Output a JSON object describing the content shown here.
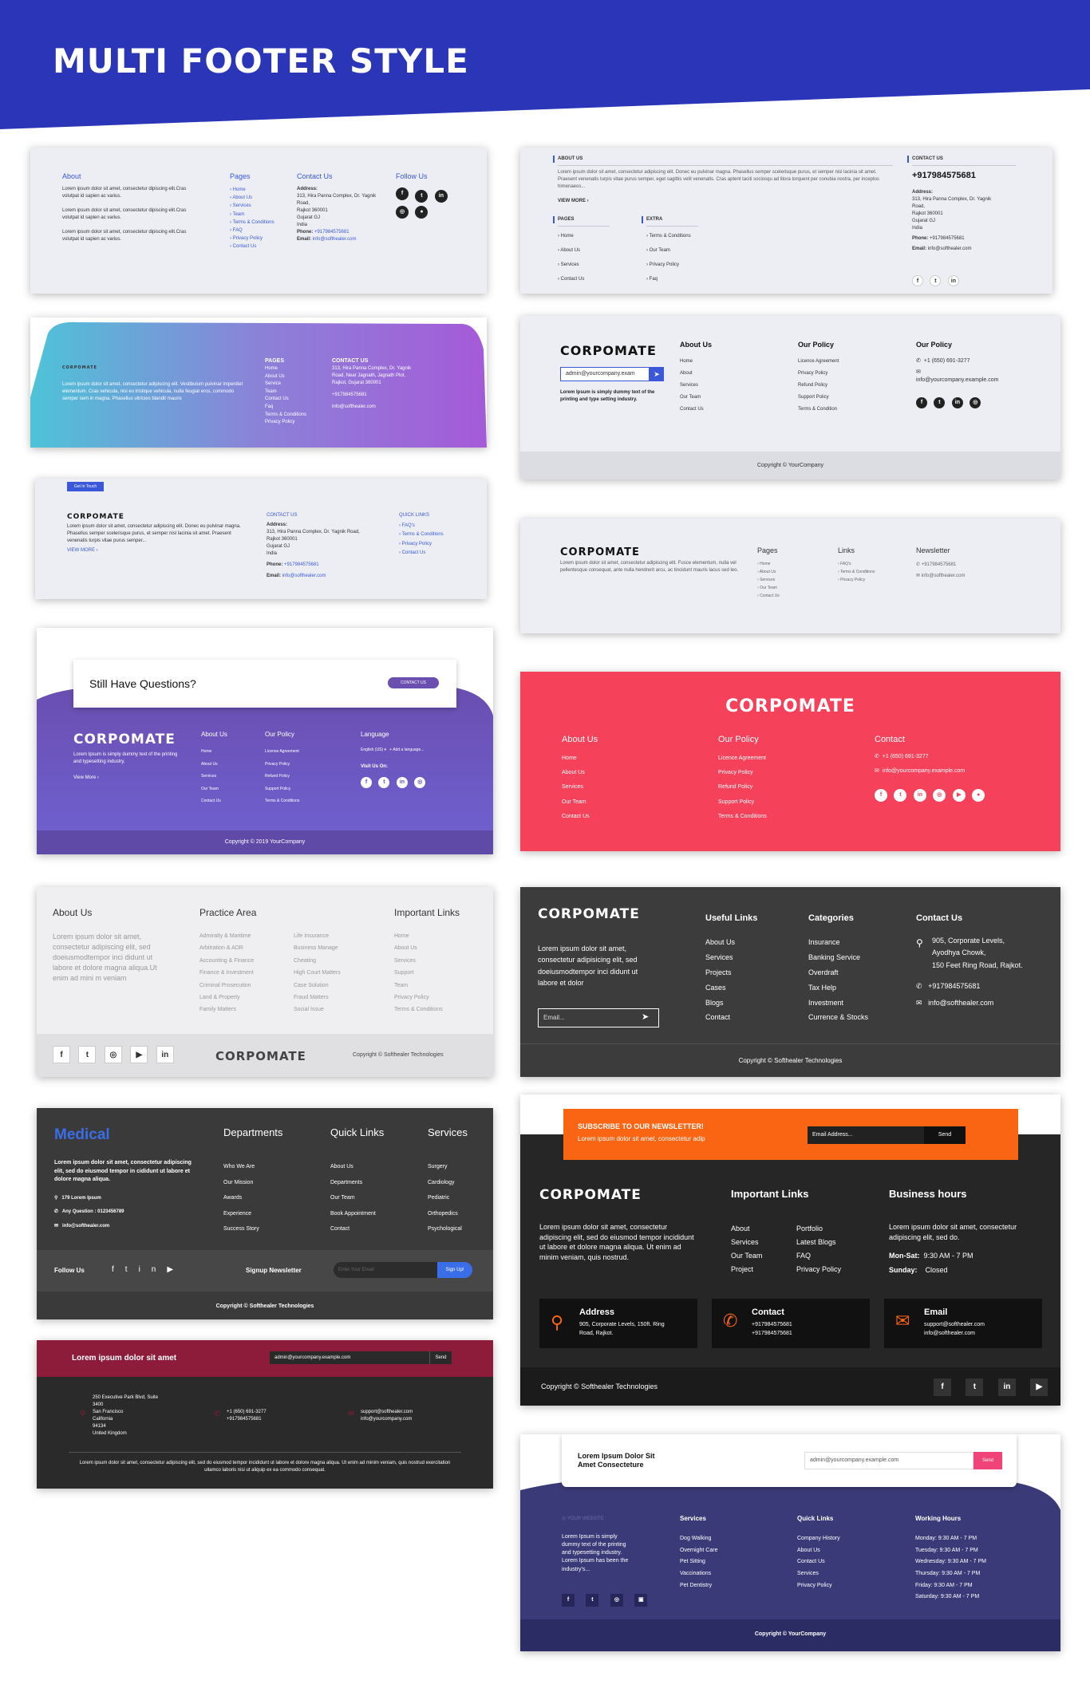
{
  "page": {
    "title": "MULTI FOOTER STYLE"
  },
  "f1": {
    "about_title": "About",
    "about_lines": [
      "Lorem ipsum dolor sit amet, consectetur dipiscing elit.Cras",
      "volutpat id sapien ac varius.",
      "",
      "Lorem ipsum dolor sit amet, consectetur dipiscing elit.Cras",
      "volutpat id sapien ac varius.",
      "",
      "Lorem ipsum dolor sit amet, consectetur dipiscing elit.Cras",
      "volutpat id sapien ac varius."
    ],
    "pages_title": "Pages",
    "pages": [
      "Home",
      "About Us",
      "Services",
      "Team",
      "Terms & Conditions",
      "FAQ",
      "Privacy Policy",
      "Contact Us"
    ],
    "contact_title": "Contact Us",
    "address_label": "Address:",
    "address_lines": [
      "313, Hira Panna Complex, Dr. Yagnik",
      "Road,",
      "Rajkot 360001",
      "Gujarat GJ",
      "India"
    ],
    "phone_label": "Phone:",
    "phone": "+917984575681",
    "email_label": "Email:",
    "email": "info@softhealer.com",
    "follow_title": "Follow Us"
  },
  "f2": {
    "about_title": "ABOUT US",
    "about_text": "Lorem ipsum dolor sit amet, consectetur adipiscing elit. Donec eu pulvinar magna. Phasellus semper scelerisque purus, et semper nisl lacinia sit amet. Praesent venenatis turpis vitae purus semper, eget sagittis velit venenatis. Cras aptent taciti sociosqu ad litora torquent per conubia nostra, per inceptos himenaeos...",
    "view_more": "VIEW MORE ›",
    "pages_title": "PAGES",
    "pages": [
      "Home",
      "About Us",
      "Services",
      "Contact Us"
    ],
    "extra_title": "EXTRA",
    "extra": [
      "Terms & Conditions",
      "Our Team",
      "Privacy Policy",
      "Faq"
    ],
    "contact_title": "CONTACT US",
    "phone_big": "+917984575681",
    "address_label": "Address:",
    "address_lines": [
      "313, Hira Panna Complex, Dr. Yagnik",
      "Road,",
      "Rajkot 360001",
      "Gujarat GJ",
      "India"
    ],
    "phone_label": "Phone:",
    "phone": "+917984575681",
    "email_label": "Email:",
    "email": "info@softhealer.com"
  },
  "f3": {
    "brand": "CORPOMATE",
    "about_text": "Lorem ipsum dolor sit amet, consectetur adipiscing elit. Vestibulum pulvinar imperdiet elementum. Cras vehicula, nisi eu tristique vehicula, nulla feugiat eros, commodo semper sem in magna. Phasellus ultricies blandit mauris",
    "pages_title": "PAGES",
    "pages": [
      "Home",
      "About Us",
      "Service",
      "Team",
      "Contact Us",
      "Faq",
      "Terms & Conditions",
      "Privacy Policy"
    ],
    "contact_title": "CONTACT US",
    "address_lines": [
      "313, Hira Panna Complex, Dr. Yagnik",
      "Road, Near Jagnath, Jagnath Plot,",
      "Rajkot, Gujarat 360001"
    ],
    "phone": "+917984575681",
    "email": "info@softhealer.com"
  },
  "f4": {
    "brand": "CORPOMATE",
    "email_placeholder": "admin@yourcompany.exam",
    "tagline": "Lorem Ipsum is simply dummy text of the printing and type setting industry.",
    "about_title": "About Us",
    "about": [
      "Home",
      "About",
      "Services",
      "Our Team",
      "Contact Us"
    ],
    "policy_title": "Our Policy",
    "policy": [
      "Licence Agreement",
      "Privacy Policy",
      "Refund Policy",
      "Support Policy",
      "Terms & Condition"
    ],
    "contact_title": "Our Policy",
    "phone": "+1 (650) 691-3277",
    "email": "info@yourcompany.example.com",
    "copyright": "Copyright © YourCompany"
  },
  "f5": {
    "tag": "Get In Touch",
    "brand": "CORPOMATE",
    "about_text": "Lorem ipsum dolor sit amet, consectetur adipiscing elit. Donec eu pulvinar magna. Phasellus semper scelerisque purus, et semper nisl lacinia sit amet. Praesent venenatis turpis vitae purus semper...",
    "view_more": "VIEW MORE ›",
    "contact_title": "CONTACT US",
    "address_label": "Address:",
    "address_lines": [
      "313, Hira Panna Complex, Dr. Yagnik Road,",
      "Rajkot 360001",
      "Gujarat GJ",
      "India"
    ],
    "phone_label": "Phone:",
    "phone": "+917984575681",
    "email_label": "Email:",
    "email": "info@softhealer.com",
    "quick_title": "QUICK LINKS",
    "quick": [
      "FAQ's",
      "Terms & Conditions",
      "Privacy Policy",
      "Contact Us"
    ]
  },
  "f6": {
    "brand": "CORPOMATE",
    "about_text": "Lorem ipsum dolor sit amet, consectetur adipiscing elit. Fusce elementum, nulla vel pellentesque consequat, ante nulla hendrerit arcu, ac tincidunt mauris lacus sed leo.",
    "pages_title": "Pages",
    "pages": [
      "Home",
      "About Us",
      "Services",
      "Our Team",
      "Contact Us"
    ],
    "links_title": "Links",
    "links": [
      "FAQ's",
      "Terms & Conditions",
      "Privacy Policy"
    ],
    "newsletter_title": "Newsletter",
    "phone": "+917984575681",
    "email": "info@softhealer.com"
  },
  "f7": {
    "question": "Still Have Questions?",
    "contact_btn": "CONTACT US",
    "brand": "CORPOMATE",
    "tagline": "Lorem Ipsum is simply dummy text of the printing and typesetting industry.",
    "view_more": "View More ›",
    "about_title": "About Us",
    "about": [
      "Home",
      "About Us",
      "Services",
      "Our Team",
      "Contact Us"
    ],
    "policy_title": "Our Policy",
    "policy": [
      "License Agreement",
      "Privacy Policy",
      "Refund Policy",
      "Support Policy",
      "Terms & Conditions"
    ],
    "language_title": "Language",
    "language_value": "English (US)",
    "add_language": "Add a language...",
    "visit_title": "Visit Us On:",
    "copyright": "Copyright © 2019 YourCompany"
  },
  "f8": {
    "brand": "CORPOMATE",
    "about_title": "About Us",
    "about": [
      "Home",
      "About Us",
      "Services",
      "Our Team",
      "Contact Us"
    ],
    "policy_title": "Our Policy",
    "policy": [
      "Licence Agreement",
      "Privacy Policy",
      "Refund Policy",
      "Support Policy",
      "Terms & Conditions"
    ],
    "contact_title": "Contact",
    "phone": "+1 (650) 691-3277",
    "email": "info@yourcompany.example.com"
  },
  "f9": {
    "about_title": "About Us",
    "about_text": "Lorem ipsum dolor sit amet, consectetur adipiscing elit, sed doeiusmodtempor inci didunt ut labore et dolore magna aliqua.Ut enim ad mini m veniam",
    "practice_title": "Practice Area",
    "practice_a": [
      "Admiralty & Maritime",
      "Arbitration & ADR",
      "Accounting & Finance",
      "Finance & Investment",
      "Criminal Prosecution",
      "Land & Property",
      "Family Matters"
    ],
    "practice_b": [
      "Life Insurance",
      "Business Manage",
      "Cheating",
      "High Court Matters",
      "Case Solution",
      "Fraud Matters",
      "Social Issue"
    ],
    "links_title": "Important Links",
    "links": [
      "Home",
      "About Us",
      "Services",
      "Support",
      "Team",
      "Privacy Policy",
      "Terms & Conditions"
    ],
    "brand": "CORPOMATE",
    "copyright": "Copyright © Softhealer Technologies"
  },
  "f10": {
    "brand": "CORPOMATE",
    "about_text": "Lorem ipsum dolor sit amet, consectetur adipisicing elit, sed doeiusmodtempor inci didunt ut labore et dolor",
    "email_placeholder": "Email...",
    "useful_title": "Useful Links",
    "useful": [
      "About Us",
      "Services",
      "Projects",
      "Cases",
      "Blogs",
      "Contact"
    ],
    "categories_title": "Categories",
    "categories": [
      "Insurance",
      "Banking Service",
      "Overdraft",
      "Tax Help",
      "Investment",
      "Currence & Stocks"
    ],
    "contact_title": "Contact Us",
    "address_lines": [
      "905, Corporate Levels,",
      "Ayodhya Chowk,",
      "150 Feet Ring Road, Rajkot."
    ],
    "phone": "+917984575681",
    "email": "info@softhealer.com",
    "copyright": "Copyright © Softhealer Technologies"
  },
  "f11": {
    "brand": "Medical",
    "about_text": "Lorem ipsum dolor sit amet, consectetur adipiscing elit, sed do eiusmod tempor in cididunt ut labore et dolore magna aliqua.",
    "address": "179 Lorem Ipsum",
    "question": "Any Question : 0123456789",
    "email": "info@softhealer.com",
    "departments_title": "Departments",
    "departments": [
      "Who We Are",
      "Our Mission",
      "Awards",
      "Experience",
      "Success Story"
    ],
    "quick_title": "Quick Links",
    "quick": [
      "About Us",
      "Departments",
      "Our Team",
      "Book Appointment",
      "Contact"
    ],
    "services_title": "Services",
    "services": [
      "Surgery",
      "Cardiology",
      "Pediatric",
      "Orthopedics",
      "Psychological"
    ],
    "follow": "Follow Us",
    "newsletter": "Signup Newsletter",
    "email_placeholder": "Enter Your Email",
    "signup_btn": "Sign Up!",
    "copyright": "Copyright © Softhealer Technologies"
  },
  "f12": {
    "subscribe_title": "SUBSCRIBE TO OUR NEWSLETTER!",
    "subscribe_text": "Lorem ipsum dolor sit amet, consectetur adip",
    "email_placeholder": "Email Address...",
    "send_btn": "Send",
    "brand": "CORPOMATE",
    "about_text": "Lorem ipsum dolor sit amet, consectetur adipiscing elit, sed do eiusmod tempor incididunt ut labore et dolore magna aliqua. Ut enim ad minim veniam, quis nostrud.",
    "links_title": "Important Links",
    "links_a": [
      "About",
      "Services",
      "Our Team",
      "Project"
    ],
    "links_b": [
      "Portfolio",
      "Latest Blogs",
      "FAQ",
      "Privacy Policy"
    ],
    "hours_title": "Business hours",
    "hours_text": "Lorem ipsum dolor sit amet, consectetur adipiscing elit, sed do.",
    "hours_1_label": "Mon-Sat:",
    "hours_1_value": "9:30 AM - 7 PM",
    "hours_2_label": "Sunday:",
    "hours_2_value": "Closed",
    "address_title": "Address",
    "address_lines": [
      "905, Corporate Levels, 150ft. Ring",
      "Road, Rajkot."
    ],
    "contact_title": "Contact",
    "contact_lines": [
      "+917984575681",
      "+917984575681"
    ],
    "email_title": "Email",
    "email_lines": [
      "support@softhealer.com",
      "info@softhealer.com"
    ],
    "copyright": "Copyright © Softhealer Technologies"
  },
  "f13": {
    "title": "Lorem ipsum dolor sit amet",
    "email_placeholder": "admin@yourcompany.example.com",
    "send_btn": "Send",
    "address_lines": [
      "250 Executive Park Blvd, Suite",
      "3400",
      "San Francisco",
      "California",
      "94134",
      "United Kingdom"
    ],
    "phone_lines": [
      "+1 (650) 691-3277",
      "+917984575681"
    ],
    "email_lines": [
      "support@softhealer.com",
      "info@yourcompany.com"
    ],
    "bottom_text": "Lorem ipsum dolor sit amet, consectetur adipiscing elit, sed do eiusmod tempor incididunt ut labore et dolore magna aliqua. Ut enim ad minim veniam, quis nostrud exercitation ullamco laboris nisi ut aliquip ex ea commodo consequat."
  },
  "f14": {
    "title": "Lorem Ipsum Dolor Sit Amet Consecteture",
    "email_placeholder": "admin@yourcompany.example.com",
    "send_btn": "Send",
    "logo": "YOUR WEBSITE",
    "about_text": "Lorem Ipsum is simply dummy text of the printing and typesetting industry. Lorem Ipsum has been the industry's...",
    "services_title": "Services",
    "services": [
      "Dog Walking",
      "Overnight Care",
      "Pet Sitting",
      "Vaccinations",
      "Pet Dentistry"
    ],
    "quick_title": "Quick Links",
    "quick": [
      "Company History",
      "About Us",
      "Contact Us",
      "Services",
      "Privacy Policy"
    ],
    "hours_title": "Working Hours",
    "hours": [
      "Monday: 9:30 AM - 7 PM",
      "Tuesday: 9:30 AM - 7 PM",
      "Wednesday: 9:30 AM - 7 PM",
      "Thursday: 9:30 AM - 7 PM",
      "Friday: 9:30 AM - 7 PM",
      "Saturday: 9:30 AM - 7 PM"
    ],
    "copyright": "Copyright © YourCompany"
  },
  "colors": {
    "hero": "#2a35b8",
    "blue": "#3a58d9",
    "pink": "#f5415a",
    "purple": "#7351b8",
    "dark": "#3c3c3c",
    "maroon": "#8c1c3a",
    "orange": "#fa6514",
    "navy": "#3a3a78"
  }
}
